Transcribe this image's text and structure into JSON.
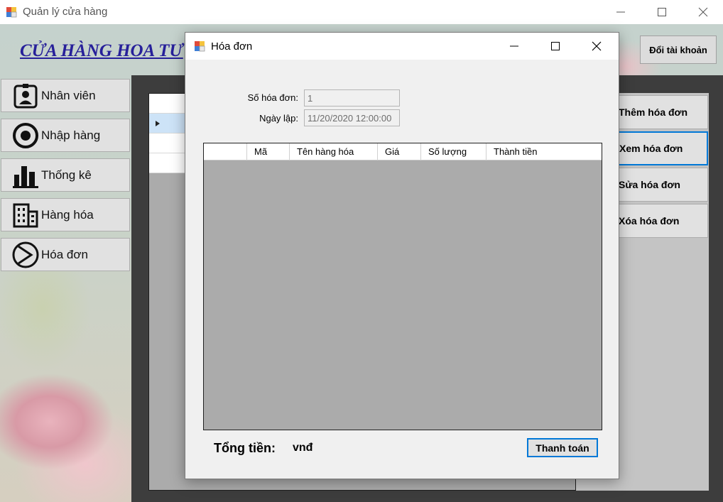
{
  "window": {
    "title": "Quản lý cửa hàng"
  },
  "header": {
    "store_name": "CỬA HÀNG HOA TƯ",
    "account_button": "Đổi tài khoản"
  },
  "sidebar": {
    "items": [
      {
        "label": "Nhân viên",
        "icon": "employee-badge-icon"
      },
      {
        "label": "Nhập hàng",
        "icon": "target-circle-icon"
      },
      {
        "label": "Thống kê",
        "icon": "bar-chart-icon"
      },
      {
        "label": "Hàng hóa",
        "icon": "building-icon"
      },
      {
        "label": "Hóa đơn",
        "icon": "play-circle-icon"
      }
    ]
  },
  "actions": {
    "items": [
      {
        "label": "Thêm hóa đơn"
      },
      {
        "label": "Xem hóa đơn"
      },
      {
        "label": "Sửa hóa đơn"
      },
      {
        "label": "Xóa hóa đơn"
      }
    ]
  },
  "dialog": {
    "title": "Hóa đơn",
    "invoice_no_label": "Số hóa đơn:",
    "invoice_no_value": "1",
    "date_label": "Ngày lập:",
    "date_value": "11/20/2020 12:00:00",
    "columns": [
      "Mã",
      "Tên hàng hóa",
      "Giá",
      "Số lượng",
      "Thành tiền"
    ],
    "total_label": "Tổng tiền:",
    "total_unit": "vnđ",
    "pay_button": "Thanh toán"
  }
}
